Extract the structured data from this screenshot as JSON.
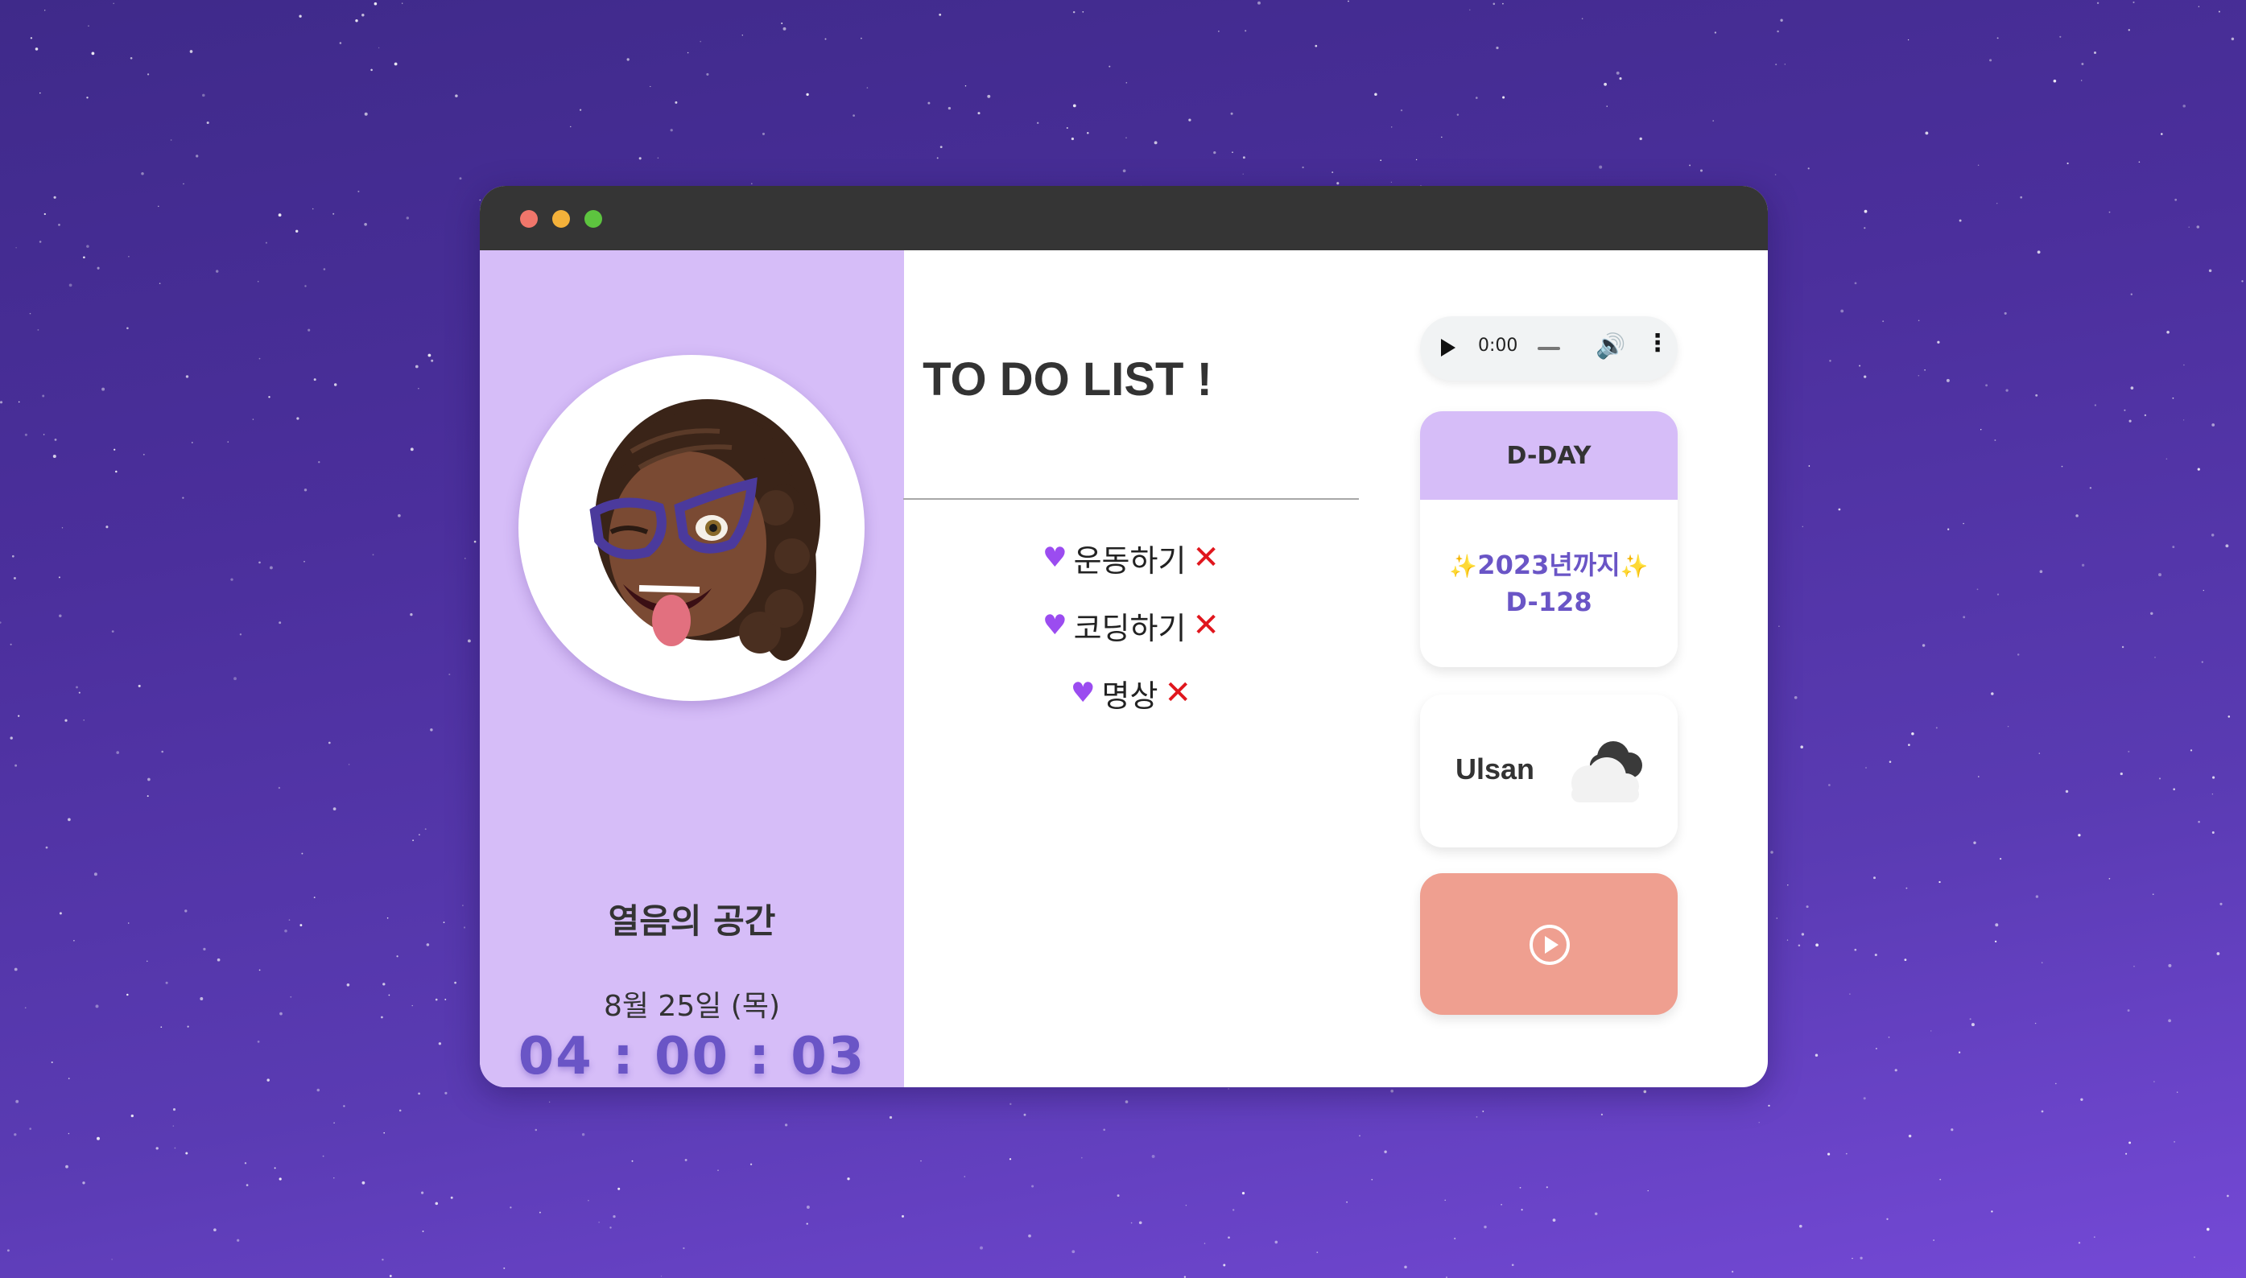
{
  "window": {
    "controls": [
      "close",
      "minimize",
      "maximize"
    ]
  },
  "profile": {
    "avatar_icon": "memoji-avatar-icon",
    "space_title": "열음의 공간",
    "date": "8월 25일 (목)",
    "clock": "04 : 00 : 03"
  },
  "todo": {
    "title": "TO DO LIST !",
    "items": [
      {
        "label": "운동하기",
        "icon": "purple-heart-icon",
        "status_icon": "cross-mark-icon"
      },
      {
        "label": "코딩하기",
        "icon": "purple-heart-icon",
        "status_icon": "cross-mark-icon"
      },
      {
        "label": "명상",
        "icon": "purple-heart-icon",
        "status_icon": "cross-mark-icon"
      }
    ]
  },
  "audio_player": {
    "time": "0:00",
    "icons": [
      "play-icon",
      "volume-icon",
      "more-options-icon"
    ]
  },
  "dday": {
    "header": "D-DAY",
    "line1": "2023년까지",
    "line2": "D-128"
  },
  "weather": {
    "city": "Ulsan",
    "icon": "cloud-icon"
  },
  "music_button": {
    "icon": "play-circle-icon"
  },
  "colors": {
    "accent_purple": "#6a55c6",
    "panel_lavender": "#d6bdf8",
    "play_card": "#ef9f90",
    "titlebar": "#353535"
  }
}
